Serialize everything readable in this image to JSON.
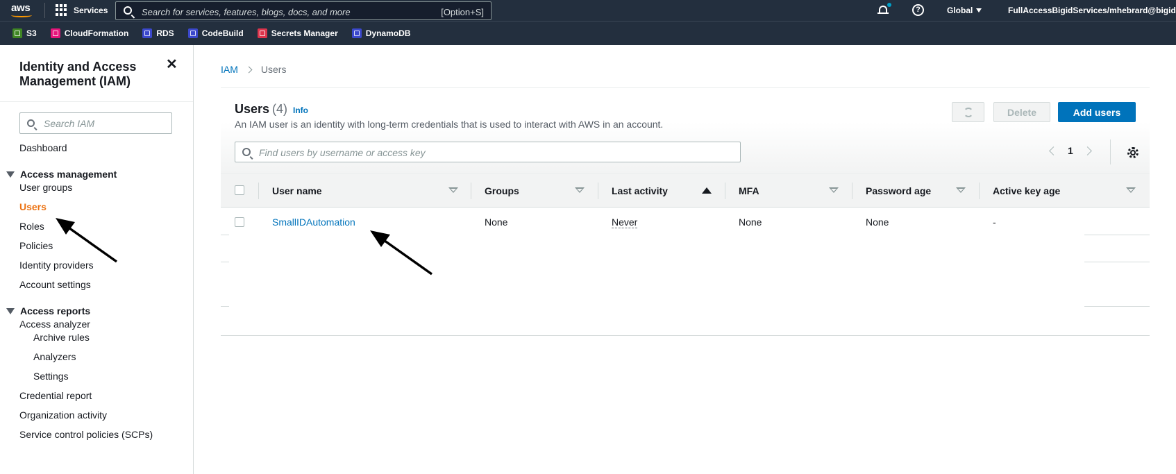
{
  "topnav": {
    "logo_text": "aws",
    "services_label": "Services",
    "search_placeholder": "Search for services, features, blogs, docs, and more",
    "search_shortcut": "[Option+S]",
    "region": "Global",
    "account": "FullAccessBigidServices/mhebrard@bigid.co"
  },
  "favorites": [
    {
      "label": "S3",
      "color": "#3f8624"
    },
    {
      "label": "CloudFormation",
      "color": "#e7157b"
    },
    {
      "label": "RDS",
      "color": "#3b48cc"
    },
    {
      "label": "CodeBuild",
      "color": "#3b48cc"
    },
    {
      "label": "Secrets Manager",
      "color": "#dd344c"
    },
    {
      "label": "DynamoDB",
      "color": "#3b48cc"
    }
  ],
  "sidebar": {
    "title": "Identity and Access Management (IAM)",
    "close_glyph": "✕",
    "search_placeholder": "Search IAM",
    "dashboard": "Dashboard",
    "access_management": {
      "heading": "Access management",
      "items": [
        "User groups",
        "Users",
        "Roles",
        "Policies",
        "Identity providers",
        "Account settings"
      ]
    },
    "access_reports": {
      "heading": "Access reports",
      "items": [
        "Access analyzer",
        "Archive rules",
        "Analyzers",
        "Settings",
        "Credential report",
        "Organization activity",
        "Service control policies (SCPs)"
      ]
    }
  },
  "breadcrumb": {
    "root": "IAM",
    "current": "Users"
  },
  "users_panel": {
    "title": "Users",
    "count": "(4)",
    "info": "Info",
    "description": "An IAM user is an identity with long-term credentials that is used to interact with AWS in an account.",
    "delete_label": "Delete",
    "add_label": "Add users",
    "filter_placeholder": "Find users by username or access key",
    "page": "1"
  },
  "table": {
    "columns": [
      "User name",
      "Groups",
      "Last activity",
      "MFA",
      "Password age",
      "Active key age"
    ],
    "rows": [
      {
        "user_name": "SmallIDAutomation",
        "groups": "None",
        "last_activity": "Never",
        "mfa": "None",
        "password_age": "None",
        "active_key_age": "-"
      }
    ]
  },
  "colors": {
    "accent": "#0073bb",
    "active_nav": "#ec7211",
    "topbar": "#232f3e"
  }
}
